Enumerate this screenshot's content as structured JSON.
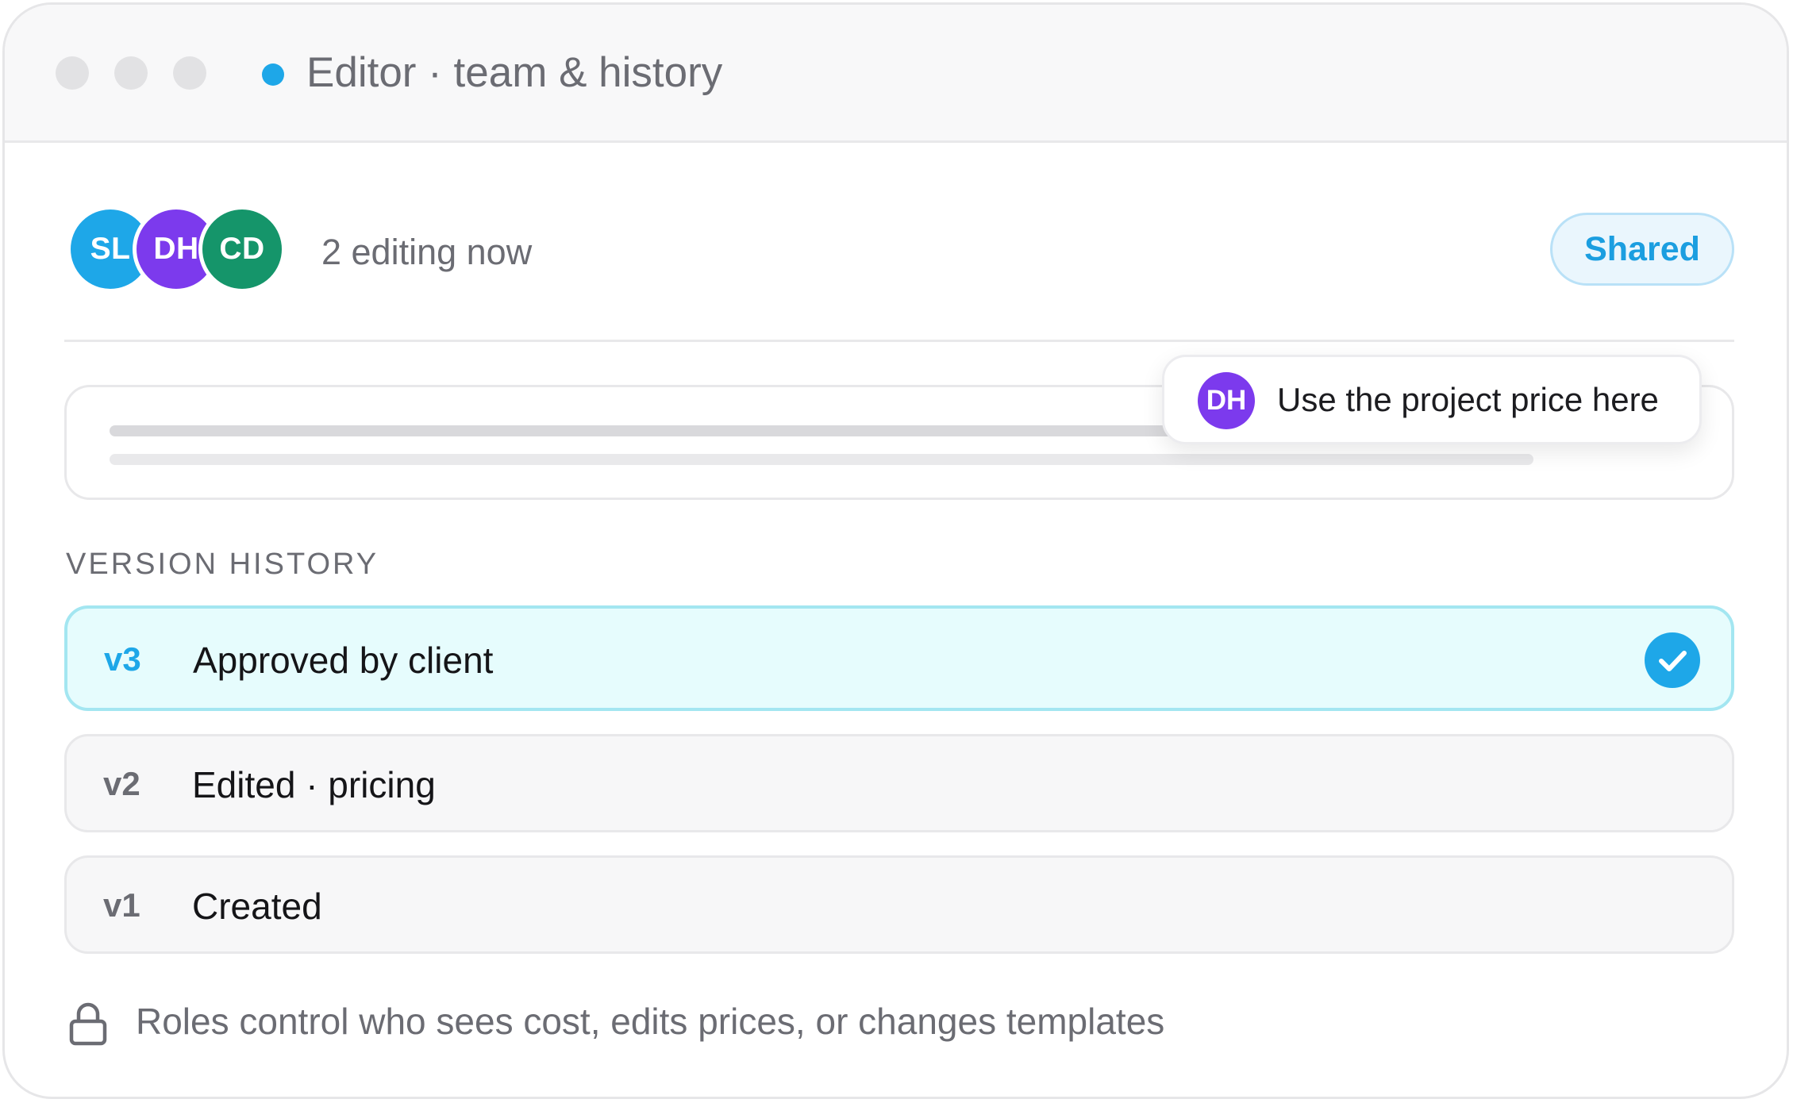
{
  "window": {
    "title": "Editor · team & history",
    "status_color": "#1ea7e8"
  },
  "presence": {
    "avatars": [
      {
        "initials": "SL",
        "color": "#1ea7e8"
      },
      {
        "initials": "DH",
        "color": "#7c3aed"
      },
      {
        "initials": "CD",
        "color": "#15956a"
      }
    ],
    "editing_text": "2 editing now",
    "badge_label": "Shared"
  },
  "comment": {
    "author_initials": "DH",
    "author_color": "#7c3aed",
    "text": "Use the project price here"
  },
  "history": {
    "section_label": "VERSION HISTORY",
    "versions": [
      {
        "num": "v3",
        "label": "Approved by client",
        "active": true
      },
      {
        "num": "v2",
        "label": "Edited · pricing",
        "active": false
      },
      {
        "num": "v1",
        "label": "Created",
        "active": false
      }
    ]
  },
  "footer": {
    "note": "Roles control who sees cost, edits prices, or changes templates",
    "icon": "lock-icon"
  }
}
